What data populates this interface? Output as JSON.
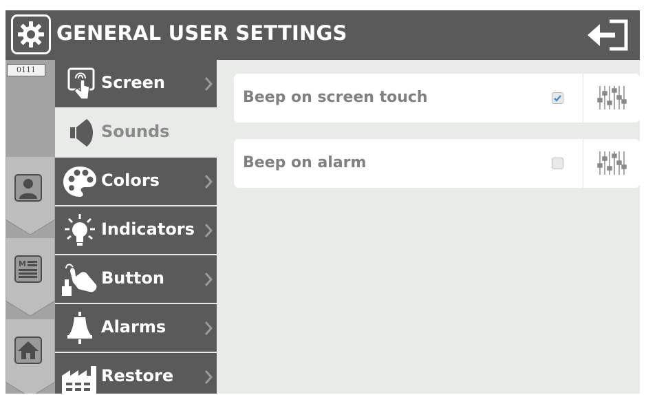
{
  "header": {
    "title": "GENERAL USER SETTINGS",
    "settings_icon": "gear-icon",
    "exit_icon": "exit-arrow-icon"
  },
  "left_strip": {
    "code": "0111",
    "tabs": [
      {
        "name": "user",
        "icon": "user-icon"
      },
      {
        "name": "menu",
        "icon": "menu-list-icon"
      },
      {
        "name": "home",
        "icon": "home-icon"
      }
    ]
  },
  "menu": {
    "items": [
      {
        "label": "Screen",
        "icon": "touch-hand-icon",
        "active": false
      },
      {
        "label": "Sounds",
        "icon": "speaker-icon",
        "active": true
      },
      {
        "label": "Colors",
        "icon": "palette-icon",
        "active": false
      },
      {
        "label": "Indicators",
        "icon": "light-bulb-icon",
        "active": false
      },
      {
        "label": "Button",
        "icon": "push-button-hand-icon",
        "active": false
      },
      {
        "label": "Alarms",
        "icon": "bell-icon",
        "active": false
      },
      {
        "label": "Restore",
        "icon": "factory-icon",
        "active": false
      }
    ]
  },
  "settings": [
    {
      "label": "Beep on screen touch",
      "checked": true,
      "adjust_icon": "sliders-icon"
    },
    {
      "label": "Beep on alarm",
      "checked": false,
      "adjust_icon": "sliders-icon"
    }
  ],
  "colors": {
    "header_bg": "#5a5a5a",
    "menu_bg": "#5a5a5a",
    "content_bg": "#e8ebe8",
    "left_strip": "#a3a3a3",
    "check_accent": "#3a8fd6"
  }
}
